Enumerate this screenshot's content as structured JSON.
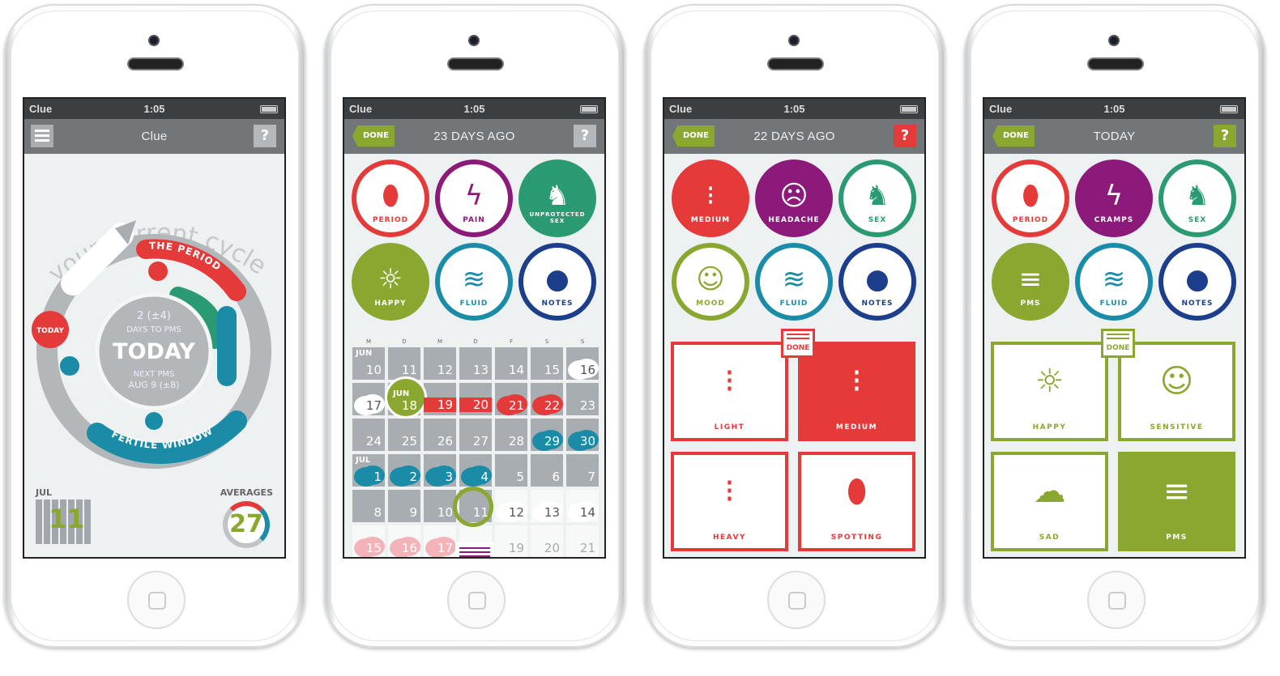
{
  "colors": {
    "red": "#e53a3a",
    "purple": "#8b1a7a",
    "green": "#2a9a72",
    "olive": "#8aa830",
    "teal": "#1a8ca8",
    "navy": "#1d3e8a",
    "gray": "#a8adb2"
  },
  "phones": [
    {
      "status": {
        "carrier": "Clue",
        "time": "1:05"
      },
      "nav": {
        "title": "Clue",
        "help": "?"
      },
      "cycle": {
        "heading": "your current cycle",
        "period_label": "THE PERIOD",
        "fertile_label": "FERTILE WINDOW",
        "today_badge": "TODAY",
        "center": {
          "days": "2 (±4)",
          "days_label": "DAYS TO PMS",
          "main": "TODAY",
          "next_label": "NEXT PMS",
          "next_date": "AUG 9 (±8)"
        }
      },
      "calendar_mini": {
        "month": "JUL",
        "day": "11"
      },
      "averages": {
        "label": "AVERAGES",
        "value": "27"
      }
    },
    {
      "status": {
        "carrier": "Clue",
        "time": "1:05"
      },
      "nav": {
        "done": "DONE",
        "title": "23 DAYS AGO",
        "help": "?"
      },
      "categories": [
        {
          "label": "PERIOD",
          "icon": "drop-icon",
          "color": "red",
          "filled": false
        },
        {
          "label": "PAIN",
          "icon": "lightning-icon",
          "color": "purple",
          "filled": false
        },
        {
          "label": "UNPROTECTED SEX",
          "icon": "reclining-figure-icon",
          "color": "green",
          "filled": true
        },
        {
          "label": "HAPPY",
          "icon": "sun-face-icon",
          "color": "olive",
          "filled": true
        },
        {
          "label": "FLUID",
          "icon": "waves-icon",
          "color": "teal",
          "filled": false
        },
        {
          "label": "NOTES",
          "icon": "speech-bubble-icon",
          "color": "navy",
          "filled": false
        }
      ],
      "calendar": {
        "weekdays": [
          "M",
          "D",
          "M",
          "D",
          "F",
          "S",
          "S"
        ],
        "rows": [
          [
            {
              "d": "10",
              "m": "JUN"
            },
            {
              "d": "11"
            },
            {
              "d": "12"
            },
            {
              "d": "13"
            },
            {
              "d": "14"
            },
            {
              "d": "15"
            },
            {
              "d": "16",
              "mark": "cloud"
            }
          ],
          [
            {
              "d": "17",
              "mark": "cloud"
            },
            {
              "d": "18",
              "m": "JUN",
              "mark": "today"
            },
            {
              "d": "19",
              "mark": "red-bar"
            },
            {
              "d": "20",
              "mark": "red-bar"
            },
            {
              "d": "21",
              "mark": "red"
            },
            {
              "d": "22",
              "mark": "red"
            },
            {
              "d": "23"
            }
          ],
          [
            {
              "d": "24"
            },
            {
              "d": "25"
            },
            {
              "d": "26"
            },
            {
              "d": "27"
            },
            {
              "d": "28"
            },
            {
              "d": "29",
              "mark": "teal"
            },
            {
              "d": "30",
              "mark": "teal"
            }
          ],
          [
            {
              "d": "1",
              "m": "JUL",
              "mark": "teal"
            },
            {
              "d": "2",
              "mark": "teal"
            },
            {
              "d": "3",
              "mark": "teal"
            },
            {
              "d": "4",
              "mark": "teal"
            },
            {
              "d": "5"
            },
            {
              "d": "6"
            },
            {
              "d": "7"
            }
          ],
          [
            {
              "d": "8"
            },
            {
              "d": "9"
            },
            {
              "d": "10"
            },
            {
              "d": "11",
              "mark": "ring"
            },
            {
              "d": "12",
              "mark": "cloud",
              "future": true
            },
            {
              "d": "13",
              "mark": "cloud",
              "future": true
            },
            {
              "d": "14",
              "mark": "cloud",
              "future": true
            }
          ],
          [
            {
              "d": "15",
              "mark": "pink",
              "future": true
            },
            {
              "d": "16",
              "mark": "pink",
              "future": true
            },
            {
              "d": "17",
              "mark": "pink",
              "future": true
            },
            {
              "d": "",
              "future": true
            },
            {
              "d": "19",
              "future": true
            },
            {
              "d": "20",
              "future": true
            },
            {
              "d": "21",
              "future": true
            }
          ]
        ]
      }
    },
    {
      "status": {
        "carrier": "Clue",
        "time": "1:05"
      },
      "nav": {
        "done": "DONE",
        "title": "22 DAYS AGO",
        "help": "?",
        "help_color": "#e53a3a"
      },
      "categories": [
        {
          "label": "MEDIUM",
          "icon": "drops-icon",
          "color": "red",
          "filled": true
        },
        {
          "label": "HEADACHE",
          "icon": "headache-face-icon",
          "color": "purple",
          "filled": true
        },
        {
          "label": "SEX",
          "icon": "reclining-figure-icon",
          "color": "green",
          "filled": false
        },
        {
          "label": "MOOD",
          "icon": "neutral-face-icon",
          "color": "olive",
          "filled": false
        },
        {
          "label": "FLUID",
          "icon": "waves-icon",
          "color": "teal",
          "filled": false
        },
        {
          "label": "NOTES",
          "icon": "speech-bubble-icon",
          "color": "navy",
          "filled": false
        }
      ],
      "panel": {
        "done": "DONE",
        "color": "red",
        "options": [
          {
            "label": "LIGHT",
            "icon": "drops-icon",
            "selected": false
          },
          {
            "label": "MEDIUM",
            "icon": "drops-icon",
            "selected": true
          },
          {
            "label": "HEAVY",
            "icon": "drops-icon",
            "selected": false
          },
          {
            "label": "SPOTTING",
            "icon": "drop-icon",
            "selected": false
          }
        ]
      }
    },
    {
      "status": {
        "carrier": "Clue",
        "time": "1:05"
      },
      "nav": {
        "done": "DONE",
        "title": "TODAY",
        "help": "?",
        "help_color": "#8aa830"
      },
      "categories": [
        {
          "label": "PERIOD",
          "icon": "drop-icon",
          "color": "red",
          "filled": false
        },
        {
          "label": "CRAMPS",
          "icon": "lightning-icon",
          "color": "purple",
          "filled": true
        },
        {
          "label": "SEX",
          "icon": "reclining-figure-icon",
          "color": "green",
          "filled": false
        },
        {
          "label": "PMS",
          "icon": "tornado-icon",
          "color": "olive",
          "filled": true
        },
        {
          "label": "FLUID",
          "icon": "waves-icon",
          "color": "teal",
          "filled": false
        },
        {
          "label": "NOTES",
          "icon": "speech-bubble-icon",
          "color": "navy",
          "filled": false
        }
      ],
      "panel": {
        "done": "DONE",
        "color": "olive",
        "options": [
          {
            "label": "HAPPY",
            "icon": "sun-face-icon",
            "selected": false
          },
          {
            "label": "SENSITIVE",
            "icon": "neutral-face-icon",
            "selected": false
          },
          {
            "label": "SAD",
            "icon": "rain-cloud-icon",
            "selected": false
          },
          {
            "label": "PMS",
            "icon": "tornado-icon",
            "selected": true
          }
        ]
      }
    }
  ]
}
